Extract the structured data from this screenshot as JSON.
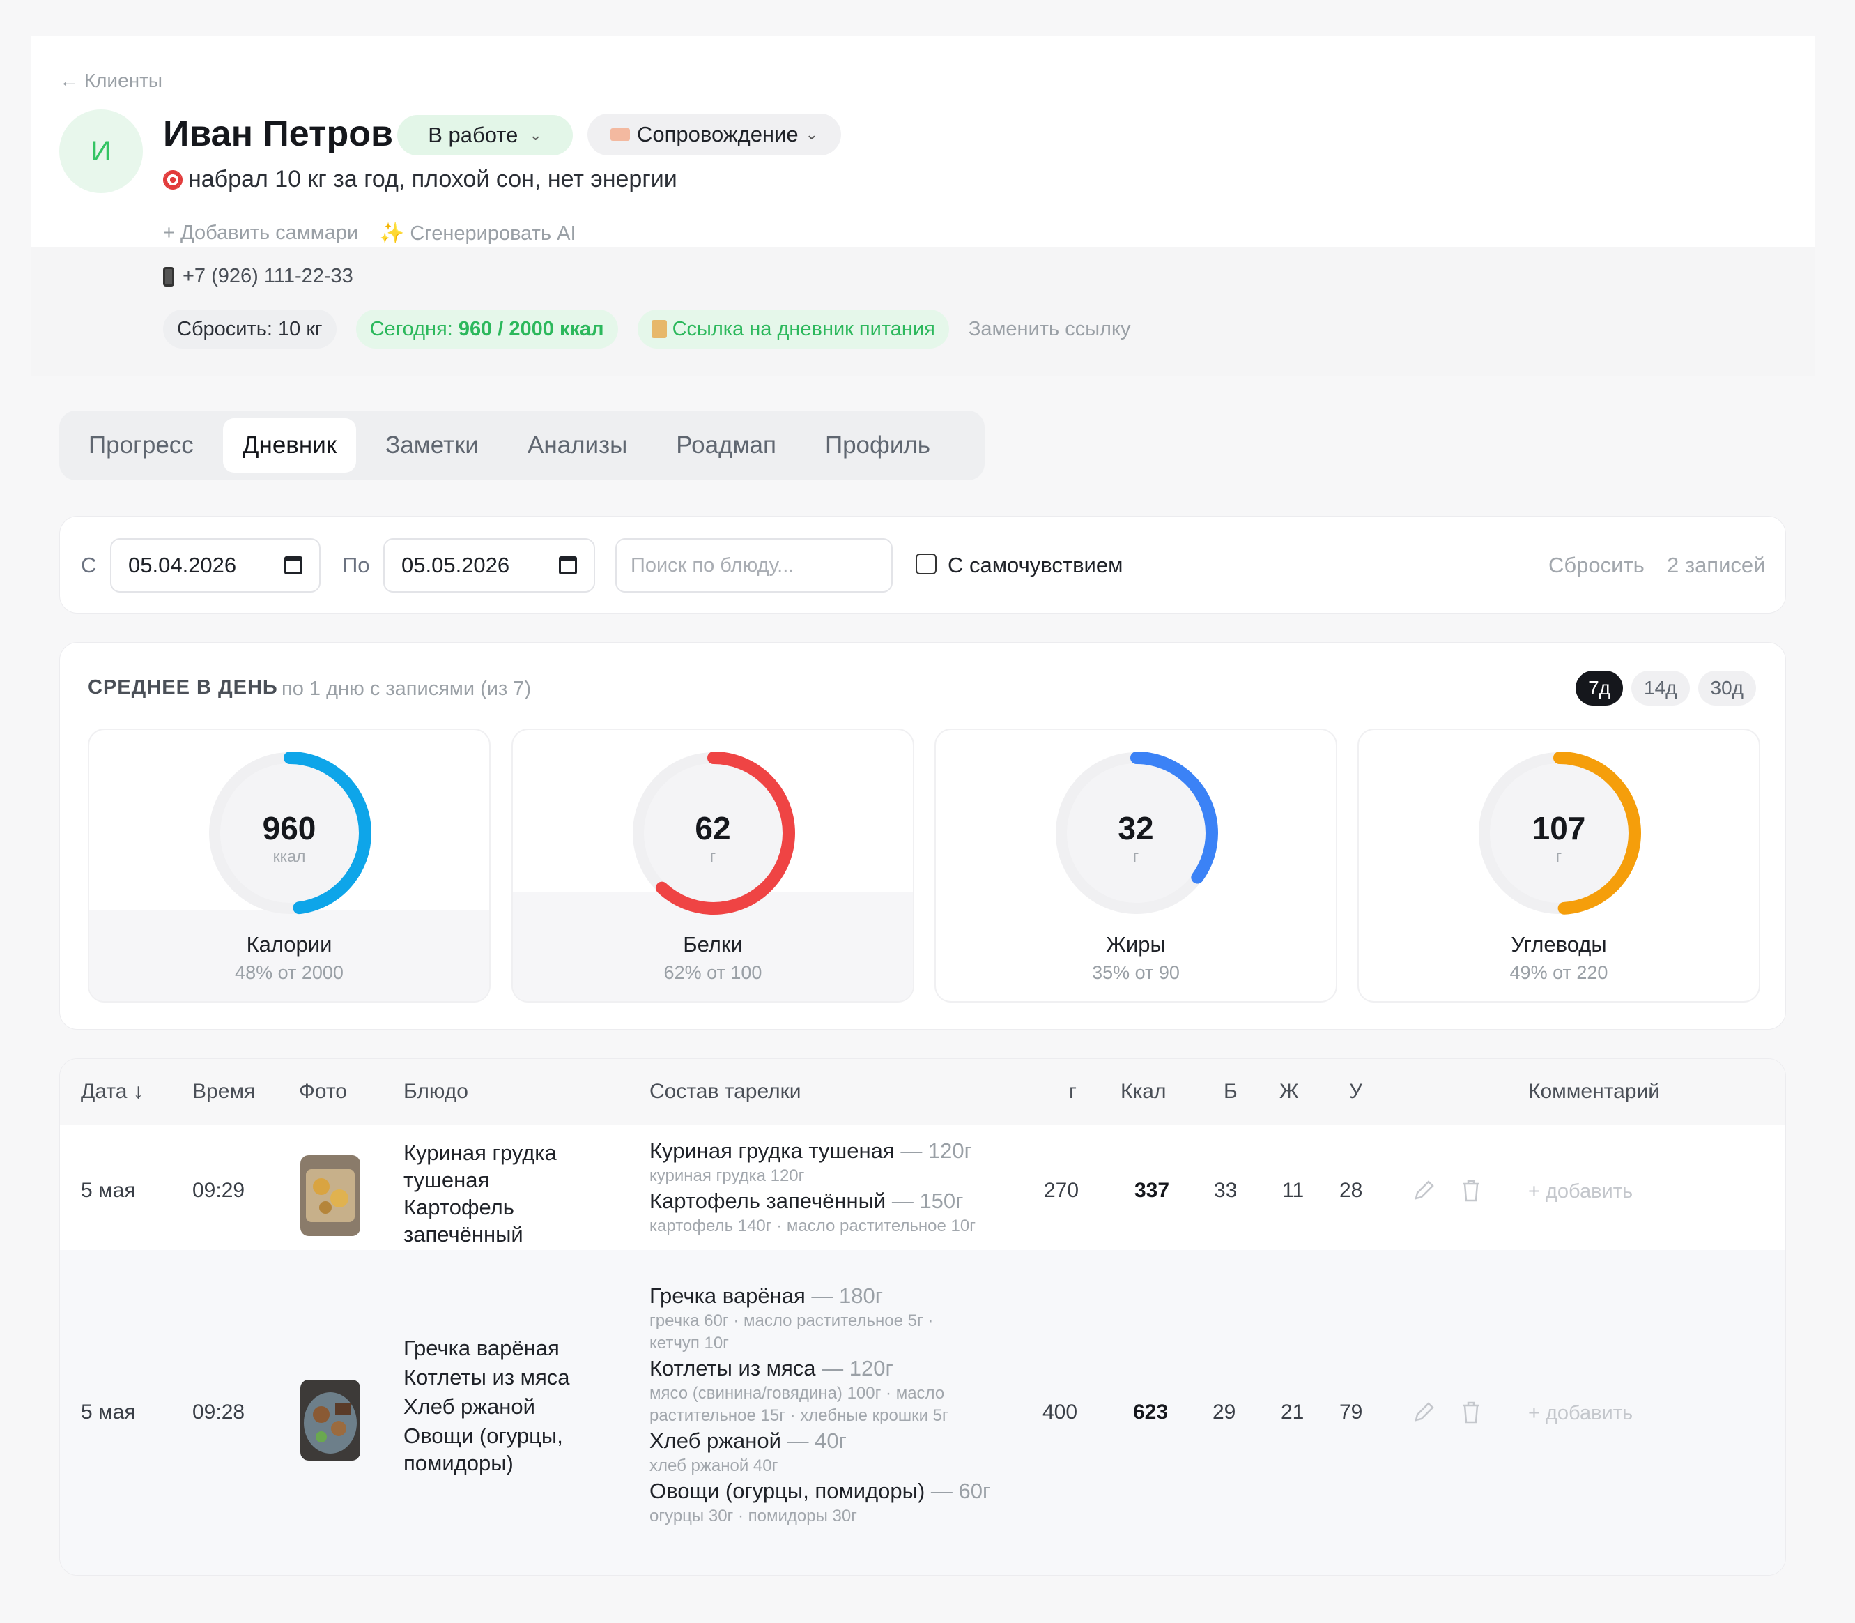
{
  "header": {
    "back_label": "← Клиенты",
    "avatar_letter": "И",
    "client_name": "Иван Петров",
    "status": "В работе",
    "program": "Сопровождение",
    "goal": "набрал 10 кг за год, плохой сон, нет энергии",
    "add_summary": "+ Добавить саммари",
    "generate_ai": "✨ Сгенерировать AI",
    "phone": "+7 (926) 111-22-33",
    "target_chip": "Сбросить: 10 кг",
    "today_label": "Сегодня:",
    "today_value": "960 / 2000 ккал",
    "diary_link": "Ссылка на дневник питания",
    "replace_link": "Заменить ссылку"
  },
  "tabs": [
    "Прогресс",
    "Дневник",
    "Заметки",
    "Анализы",
    "Роадмап",
    "Профиль"
  ],
  "active_tab": "Дневник",
  "filters": {
    "from_label": "С",
    "from_date": "05.04.2026",
    "to_label": "По",
    "to_date": "05.05.2026",
    "search_placeholder": "Поиск по блюду...",
    "wellbeing_label": "С самочувствием",
    "reset_label": "Сбросить",
    "count_label": "2 записей"
  },
  "averages": {
    "title": "СРЕДНЕЕ В ДЕНЬ",
    "subtitle": "по 1 дню с записями (из 7)",
    "periods": [
      "7д",
      "14д",
      "30д"
    ],
    "active_period": "7д",
    "macros": [
      {
        "name": "Калории",
        "value": "960",
        "unit": "ккал",
        "pct_text": "48% от 2000",
        "fraction": 0.48,
        "color": "#0ea5e9"
      },
      {
        "name": "Белки",
        "value": "62",
        "unit": "г",
        "pct_text": "62% от 100",
        "fraction": 0.62,
        "color": "#ef4444"
      },
      {
        "name": "Жиры",
        "value": "32",
        "unit": "г",
        "pct_text": "35% от 90",
        "fraction": 0.35,
        "color": "#3b82f6"
      },
      {
        "name": "Углеводы",
        "value": "107",
        "unit": "г",
        "pct_text": "49% от 220",
        "fraction": 0.49,
        "color": "#f59e0b"
      }
    ]
  },
  "table": {
    "headers": {
      "date": "Дата ↓",
      "time": "Время",
      "photo": "Фото",
      "dish": "Блюдо",
      "plate": "Состав тарелки",
      "grams": "г",
      "kcal": "Ккал",
      "protein": "Б",
      "fat": "Ж",
      "carbs": "У",
      "comment": "Комментарий"
    },
    "rows": [
      {
        "date": "5 мая",
        "time": "09:29",
        "dishes": [
          "Куриная грудка",
          "тушеная",
          "Картофель",
          "запечённый"
        ],
        "plate": [
          {
            "name": "Куриная грудка тушеная",
            "weight": "— 120г",
            "detail": "куриная грудка 120г"
          },
          {
            "name": "Картофель запечённый",
            "weight": "— 150г",
            "detail": "картофель 140г · масло растительное 10г"
          }
        ],
        "grams": "270",
        "kcal": "337",
        "protein": "33",
        "fat": "11",
        "carbs": "28",
        "comment": "+ добавить"
      },
      {
        "date": "5 мая",
        "time": "09:28",
        "dishes": [
          "Гречка варёная",
          "Котлеты из мяса",
          "Хлеб ржаной",
          "Овощи (огурцы,",
          "помидоры)"
        ],
        "plate": [
          {
            "name": "Гречка варёная",
            "weight": "— 180г",
            "detail": "гречка 60г · масло растительное 5г ·",
            "detail2": "кетчуп 10г"
          },
          {
            "name": "Котлеты из мяса",
            "weight": "— 120г",
            "detail": "мясо (свинина/говядина) 100г · масло",
            "detail2": "растительное 15г · хлебные крошки 5г"
          },
          {
            "name": "Хлеб ржаной",
            "weight": "— 40г",
            "detail": "хлеб ржаной 40г"
          },
          {
            "name": "Овощи (огурцы, помидоры)",
            "weight": "— 60г",
            "detail": "огурцы 30г · помидоры 30г"
          }
        ],
        "grams": "400",
        "kcal": "623",
        "protein": "29",
        "fat": "21",
        "carbs": "79",
        "comment": "+ добавить"
      }
    ]
  }
}
